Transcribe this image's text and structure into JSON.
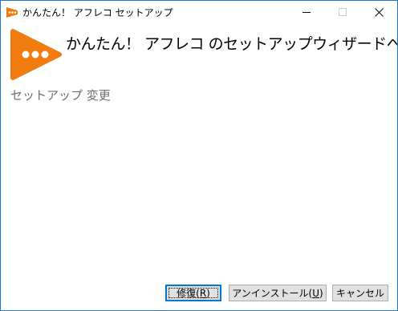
{
  "window": {
    "title": "かんたん！ アフレコ セットアップ",
    "brand_color": "#f07c10",
    "border_color": "#1979ca"
  },
  "title_controls": {
    "minimize_icon": "minimize-icon",
    "maximize_icon": "maximize-icon",
    "close_icon": "close-icon"
  },
  "header": {
    "heading": "かんたん！ アフレコ のセットアップウィザードへようこそ",
    "subheading": "セットアップ 変更"
  },
  "buttons": {
    "repair": {
      "label": "修復",
      "hotkey": "R"
    },
    "uninstall": {
      "label": "アンインストール",
      "hotkey": "U"
    },
    "cancel": {
      "label": "キャンセル"
    }
  }
}
